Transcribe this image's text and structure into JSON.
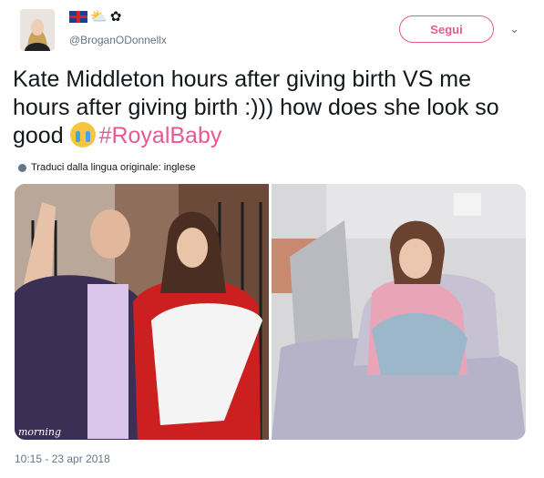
{
  "author": {
    "handle": "@BroganODonnellx",
    "flag_icons": [
      "uk-flag-icon",
      "sun-behind-cloud-icon",
      "bee-icon"
    ]
  },
  "follow_button": {
    "label": "Segui"
  },
  "tweet": {
    "text_part1": "Kate Middleton hours after giving birth VS me hours after giving birth :))) how does she look so good ",
    "emoji": "loudly-crying-face-icon",
    "hashtag": "#RoyalBaby"
  },
  "translate": {
    "label": "Traduci dalla lingua originale: inglese"
  },
  "media": [
    {
      "description_icon": "photo-royal-couple",
      "watermark": "morning"
    },
    {
      "description_icon": "photo-hospital-bed"
    }
  ],
  "timestamp": "10:15 - 23 apr 2018",
  "colors": {
    "accent": "#e8598e",
    "muted": "#657786"
  }
}
